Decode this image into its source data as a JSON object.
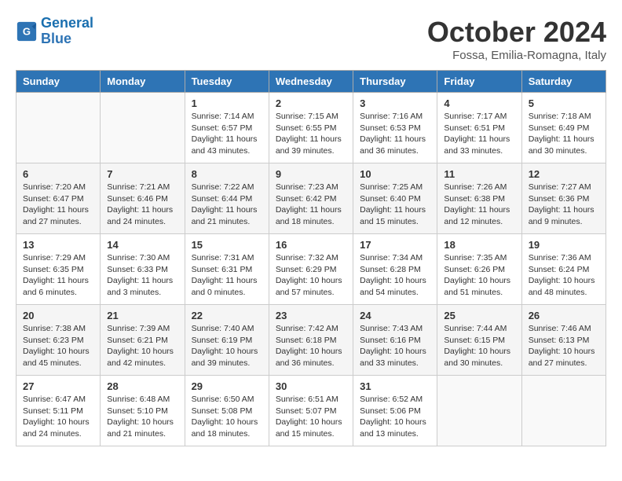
{
  "header": {
    "logo_line1": "General",
    "logo_line2": "Blue",
    "month": "October 2024",
    "location": "Fossa, Emilia-Romagna, Italy"
  },
  "days_of_week": [
    "Sunday",
    "Monday",
    "Tuesday",
    "Wednesday",
    "Thursday",
    "Friday",
    "Saturday"
  ],
  "weeks": [
    [
      {
        "day": "",
        "info": ""
      },
      {
        "day": "",
        "info": ""
      },
      {
        "day": "1",
        "info": "Sunrise: 7:14 AM\nSunset: 6:57 PM\nDaylight: 11 hours and 43 minutes."
      },
      {
        "day": "2",
        "info": "Sunrise: 7:15 AM\nSunset: 6:55 PM\nDaylight: 11 hours and 39 minutes."
      },
      {
        "day": "3",
        "info": "Sunrise: 7:16 AM\nSunset: 6:53 PM\nDaylight: 11 hours and 36 minutes."
      },
      {
        "day": "4",
        "info": "Sunrise: 7:17 AM\nSunset: 6:51 PM\nDaylight: 11 hours and 33 minutes."
      },
      {
        "day": "5",
        "info": "Sunrise: 7:18 AM\nSunset: 6:49 PM\nDaylight: 11 hours and 30 minutes."
      }
    ],
    [
      {
        "day": "6",
        "info": "Sunrise: 7:20 AM\nSunset: 6:47 PM\nDaylight: 11 hours and 27 minutes."
      },
      {
        "day": "7",
        "info": "Sunrise: 7:21 AM\nSunset: 6:46 PM\nDaylight: 11 hours and 24 minutes."
      },
      {
        "day": "8",
        "info": "Sunrise: 7:22 AM\nSunset: 6:44 PM\nDaylight: 11 hours and 21 minutes."
      },
      {
        "day": "9",
        "info": "Sunrise: 7:23 AM\nSunset: 6:42 PM\nDaylight: 11 hours and 18 minutes."
      },
      {
        "day": "10",
        "info": "Sunrise: 7:25 AM\nSunset: 6:40 PM\nDaylight: 11 hours and 15 minutes."
      },
      {
        "day": "11",
        "info": "Sunrise: 7:26 AM\nSunset: 6:38 PM\nDaylight: 11 hours and 12 minutes."
      },
      {
        "day": "12",
        "info": "Sunrise: 7:27 AM\nSunset: 6:36 PM\nDaylight: 11 hours and 9 minutes."
      }
    ],
    [
      {
        "day": "13",
        "info": "Sunrise: 7:29 AM\nSunset: 6:35 PM\nDaylight: 11 hours and 6 minutes."
      },
      {
        "day": "14",
        "info": "Sunrise: 7:30 AM\nSunset: 6:33 PM\nDaylight: 11 hours and 3 minutes."
      },
      {
        "day": "15",
        "info": "Sunrise: 7:31 AM\nSunset: 6:31 PM\nDaylight: 11 hours and 0 minutes."
      },
      {
        "day": "16",
        "info": "Sunrise: 7:32 AM\nSunset: 6:29 PM\nDaylight: 10 hours and 57 minutes."
      },
      {
        "day": "17",
        "info": "Sunrise: 7:34 AM\nSunset: 6:28 PM\nDaylight: 10 hours and 54 minutes."
      },
      {
        "day": "18",
        "info": "Sunrise: 7:35 AM\nSunset: 6:26 PM\nDaylight: 10 hours and 51 minutes."
      },
      {
        "day": "19",
        "info": "Sunrise: 7:36 AM\nSunset: 6:24 PM\nDaylight: 10 hours and 48 minutes."
      }
    ],
    [
      {
        "day": "20",
        "info": "Sunrise: 7:38 AM\nSunset: 6:23 PM\nDaylight: 10 hours and 45 minutes."
      },
      {
        "day": "21",
        "info": "Sunrise: 7:39 AM\nSunset: 6:21 PM\nDaylight: 10 hours and 42 minutes."
      },
      {
        "day": "22",
        "info": "Sunrise: 7:40 AM\nSunset: 6:19 PM\nDaylight: 10 hours and 39 minutes."
      },
      {
        "day": "23",
        "info": "Sunrise: 7:42 AM\nSunset: 6:18 PM\nDaylight: 10 hours and 36 minutes."
      },
      {
        "day": "24",
        "info": "Sunrise: 7:43 AM\nSunset: 6:16 PM\nDaylight: 10 hours and 33 minutes."
      },
      {
        "day": "25",
        "info": "Sunrise: 7:44 AM\nSunset: 6:15 PM\nDaylight: 10 hours and 30 minutes."
      },
      {
        "day": "26",
        "info": "Sunrise: 7:46 AM\nSunset: 6:13 PM\nDaylight: 10 hours and 27 minutes."
      }
    ],
    [
      {
        "day": "27",
        "info": "Sunrise: 6:47 AM\nSunset: 5:11 PM\nDaylight: 10 hours and 24 minutes."
      },
      {
        "day": "28",
        "info": "Sunrise: 6:48 AM\nSunset: 5:10 PM\nDaylight: 10 hours and 21 minutes."
      },
      {
        "day": "29",
        "info": "Sunrise: 6:50 AM\nSunset: 5:08 PM\nDaylight: 10 hours and 18 minutes."
      },
      {
        "day": "30",
        "info": "Sunrise: 6:51 AM\nSunset: 5:07 PM\nDaylight: 10 hours and 15 minutes."
      },
      {
        "day": "31",
        "info": "Sunrise: 6:52 AM\nSunset: 5:06 PM\nDaylight: 10 hours and 13 minutes."
      },
      {
        "day": "",
        "info": ""
      },
      {
        "day": "",
        "info": ""
      }
    ]
  ]
}
